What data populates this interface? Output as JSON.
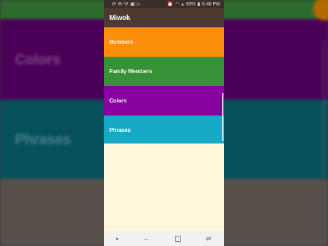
{
  "background": {
    "labels": [
      "Colors",
      "Phrases"
    ]
  },
  "status_bar": {
    "left_icons": [
      "sync-icon",
      "message-icon",
      "usb-icon",
      "image-icon",
      "play-icon"
    ],
    "battery": "68%",
    "time": "6:46 PM"
  },
  "app": {
    "title": "Miwok"
  },
  "categories": [
    {
      "label": "Numbers",
      "color": "#fd8e09"
    },
    {
      "label": "Family Members",
      "color": "#379237"
    },
    {
      "label": "Colors",
      "color": "#8800a0"
    },
    {
      "label": "Phrases",
      "color": "#16aac7"
    }
  ],
  "colors": {
    "app_bar": "#4d3b31",
    "status_bar": "#3c2e28",
    "content_bg": "#fff8dc"
  }
}
